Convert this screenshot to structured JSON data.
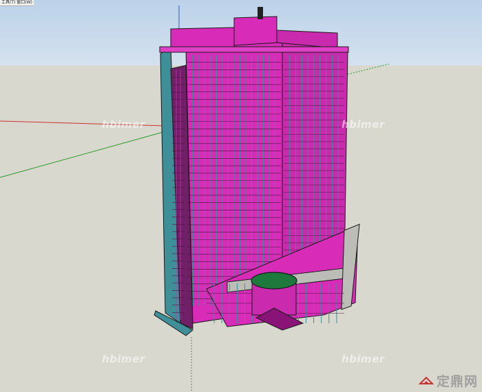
{
  "window": {
    "menu_stub": "工具(T) 窗口(W)"
  },
  "scene": {
    "subject": "high-rise-building-model",
    "colors": {
      "sky_top": "#bcd2e9",
      "ground": "#d9d8ce",
      "facade_magenta": "#d72bb8",
      "facade_dark": "#8a1378",
      "mullion_teal": "#3f8f98",
      "outline": "#1a1a1a",
      "dome_green": "#1d7a3c",
      "axis_red": "#c33",
      "axis_green": "#2a9a2a"
    }
  },
  "watermarks": [
    {
      "text": "hbimer"
    },
    {
      "text": "hbimer"
    },
    {
      "text": "hbimer"
    },
    {
      "text": "hbimer"
    }
  ],
  "brand": {
    "text": "定鼎网",
    "icon": "dingding-logo-icon"
  }
}
